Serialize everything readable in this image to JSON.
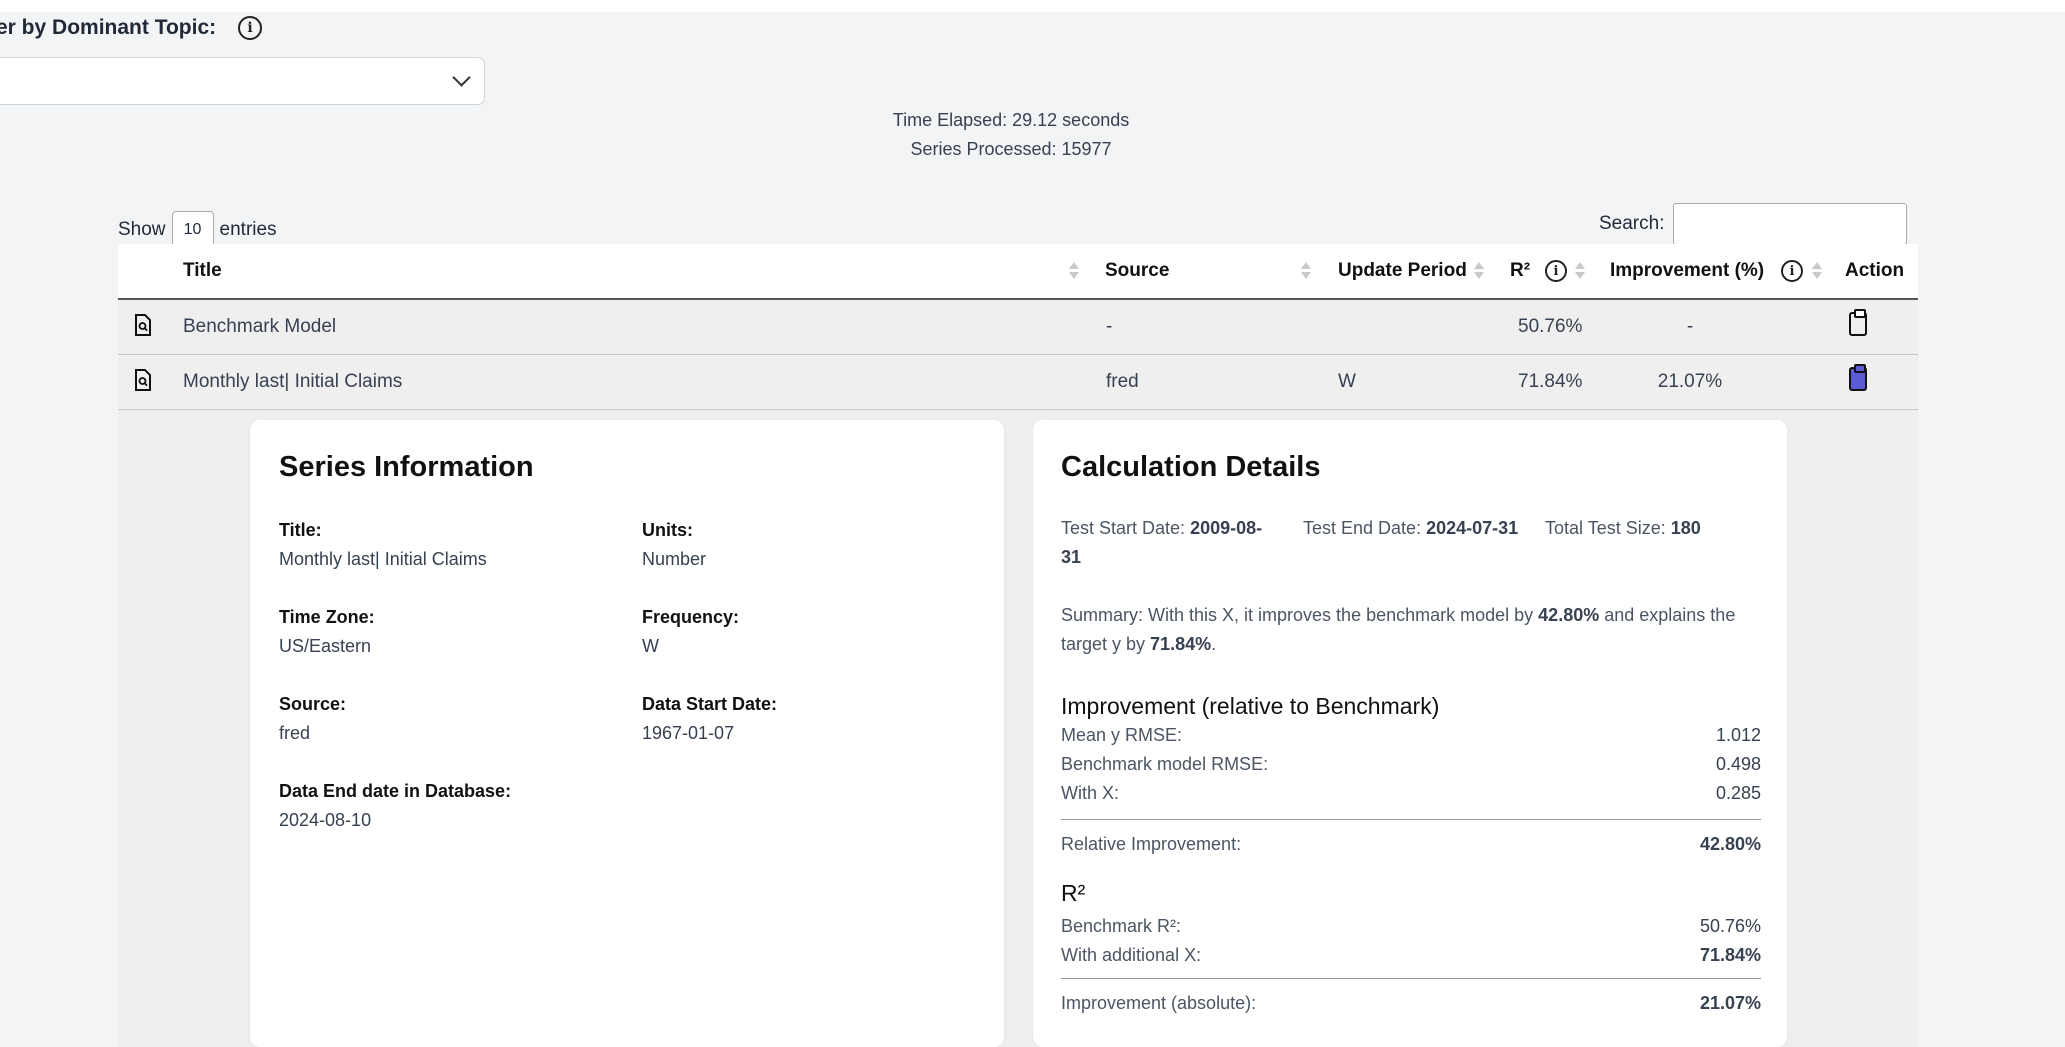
{
  "filter": {
    "label": "er by Dominant Topic:",
    "info_icon": "info-icon",
    "selected": ""
  },
  "stats": {
    "time_elapsed": "Time Elapsed: 29.12 seconds",
    "series_processed": "Series Processed: 15977"
  },
  "table_controls": {
    "show_label": "Show",
    "entries_value": "10",
    "entries_label": "entries",
    "search_label": "Search:",
    "search_value": ""
  },
  "columns": {
    "title": "Title",
    "source": "Source",
    "update_period": "Update Period",
    "r2": "R²",
    "improvement": "Improvement (%)",
    "action": "Action"
  },
  "rows": [
    {
      "title": "Benchmark Model",
      "source": "-",
      "update_period": "",
      "r2": "50.76%",
      "improvement": "-",
      "action_icon": "clipboard-icon"
    },
    {
      "title": "Monthly last| Initial Claims",
      "source": "fred",
      "update_period": "W",
      "r2": "71.84%",
      "improvement": "21.07%",
      "action_icon": "clipboard-filled-icon"
    }
  ],
  "series_info": {
    "heading": "Series Information",
    "title_label": "Title:",
    "title_value": "Monthly last| Initial Claims",
    "units_label": "Units:",
    "units_value": "Number",
    "tz_label": "Time Zone:",
    "tz_value": "US/Eastern",
    "freq_label": "Frequency:",
    "freq_value": "W",
    "source_label": "Source:",
    "source_value": "fred",
    "start_label": "Data Start Date:",
    "start_value": "1967-01-07",
    "end_label": "Data End date in Database:",
    "end_value": "2024-08-10"
  },
  "calc": {
    "heading": "Calculation Details",
    "test_start_label": "Test Start Date:",
    "test_start_value": "2009-08-31",
    "test_end_label": "Test End Date:",
    "test_end_value": "2024-07-31",
    "test_size_label": "Total Test Size:",
    "test_size_value": "180",
    "summary_a": "Summary: With this X, it improves the benchmark model by ",
    "summary_pct1": "42.80%",
    "summary_b": " and explains the target y by ",
    "summary_pct2": "71.84%",
    "summary_c": ".",
    "improvement_heading": "Improvement (relative to Benchmark)",
    "mean_rmse_label": "Mean y RMSE:",
    "mean_rmse_value": "1.012",
    "bench_rmse_label": "Benchmark model RMSE:",
    "bench_rmse_value": "0.498",
    "withx_label": "With X:",
    "withx_value": "0.285",
    "rel_label": "Relative Improvement:",
    "rel_value": "42.80%",
    "r2_heading": "R²",
    "bench_r2_label": "Benchmark R²:",
    "bench_r2_value": "50.76%",
    "addx_label": "With additional X:",
    "addx_value": "71.84%",
    "abs_label": "Improvement (absolute):",
    "abs_value": "21.07%"
  }
}
